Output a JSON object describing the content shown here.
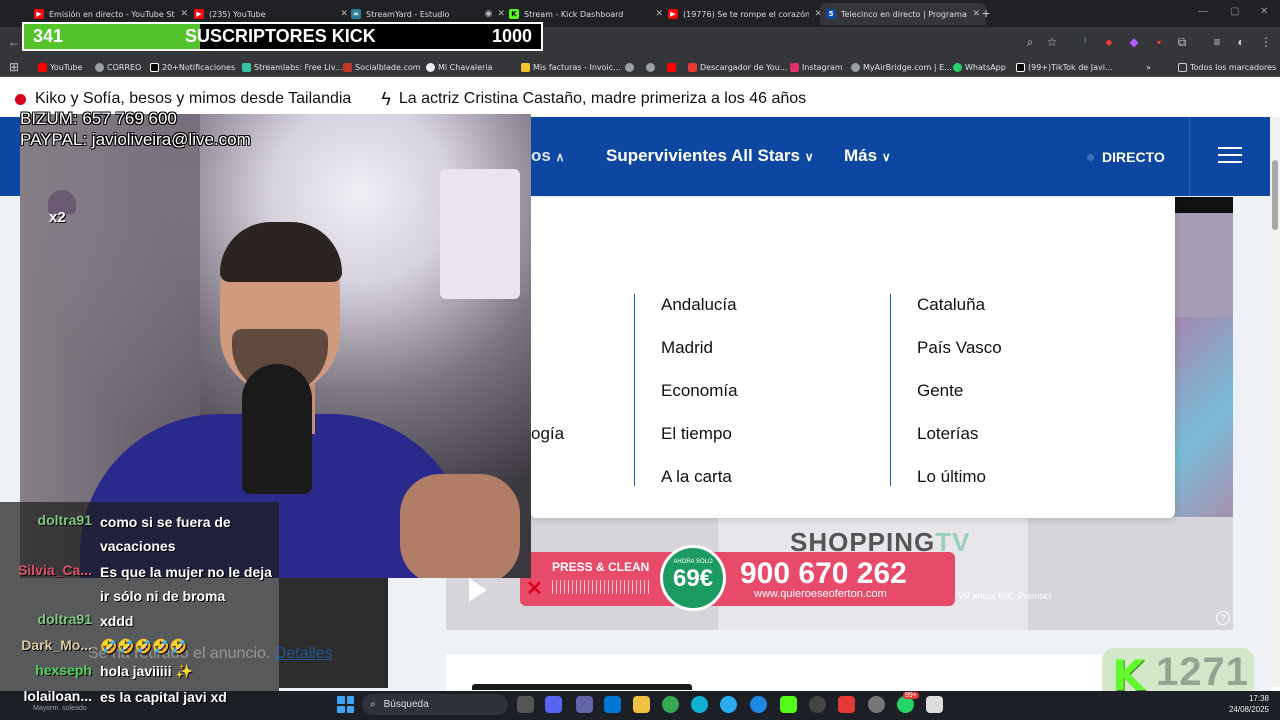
{
  "browser": {
    "tabs": [
      {
        "title": "Emisión en directo - YouTube Studio",
        "color": "#ff0000"
      },
      {
        "title": "(235) YouTube",
        "color": "#ff0000"
      },
      {
        "title": "StreamYard - Estudio",
        "color": "#2d7d9a"
      },
      {
        "title": "Stream - Kick Dashboard",
        "color": "#53fc18"
      },
      {
        "title": "(19776) Se te rompe el corazón...",
        "color": "#ff0000"
      },
      {
        "title": "Telecinco en directo | Programación",
        "color": "#0d47a1"
      }
    ],
    "url_hint": "directo",
    "bookmarks": [
      "YouTube",
      "CORREO",
      "20+Notificaciones",
      "Streamlabs: Free Liv...",
      "Socialblade.com",
      "Mi Chavaleria",
      "Mis facturas - Invoic...",
      "Descargador de You...",
      "Instagram",
      "MyAirBridge.com | E...",
      "WhatsApp",
      "(99+)TikTok de Javi..."
    ],
    "all_bookmarks": "Todos los marcadores"
  },
  "site": {
    "ticker": [
      "Kiko y Sofía, besos y mimos desde Tailandia",
      "La actriz Cristina Castaño, madre primeriza a los 46 años"
    ],
    "nav": {
      "partial": "os",
      "survivors": "Supervivientes All Stars",
      "more": "Más",
      "live": "DIRECTO"
    },
    "dropdown": {
      "partial_left": "ogía",
      "col2": [
        "Andalucía",
        "Madrid",
        "Economía",
        "El tiempo",
        "A la carta"
      ],
      "col3": [
        "Cataluña",
        "País Vasco",
        "Gente",
        "Loterías",
        "Lo último"
      ]
    },
    "ad": {
      "brand": "SHOPPING",
      "brand_suffix": "TV",
      "product": "PRESS & CLEAN",
      "badge_small": "AHORA SÓLO",
      "badge_price": "69€",
      "phone": "900 670 262",
      "url": "www.quieroeseoferton.com",
      "promo": "VP ahora 69€. Promoci",
      "removed_text": "Se ha retirado el anuncio.",
      "details_link": "Detalles"
    }
  },
  "overlay": {
    "subs": {
      "current": "341",
      "label": "SUSCRIPTORES KICK",
      "goal": "1000",
      "progress": 0.341
    },
    "donate": {
      "bizum": "BIZUM: 657 769 600",
      "paypal": "PAYPAL: javioliveira@live.com"
    },
    "multiplier": "x2",
    "viewers": "1271",
    "chat": [
      {
        "user": "doltra91",
        "color": "#7ec87e",
        "message": "como si se fuera de vacaciones"
      },
      {
        "user": "Silvia_Ca...",
        "color": "#e0566a",
        "message": "Es que la mujer no le deja ir sólo ni de broma"
      },
      {
        "user": "doltra91",
        "color": "#7ec87e",
        "message": "xddd"
      },
      {
        "user": "Dark_Mo...",
        "color": "#d7c9a2",
        "message": "🤣🤣🤣🤣🤣"
      },
      {
        "user": "hexseph",
        "color": "#53d45a",
        "message": "hola javiiiii ✨"
      },
      {
        "user": "lolailoan...",
        "color": "#ffffff",
        "message": "es la capital javi xd"
      }
    ]
  },
  "taskbar": {
    "weather": "Mayorm. soleado",
    "search": "Búsqueda",
    "time": "17:38",
    "date": "24/08/2025",
    "notif_badge": "99+"
  }
}
